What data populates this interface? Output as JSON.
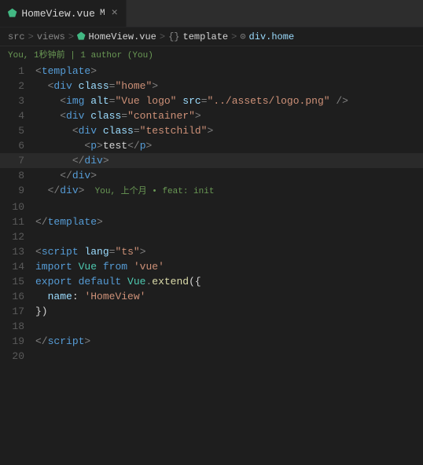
{
  "tab": {
    "vue_icon": "⬟",
    "label": "HomeView.vue",
    "modified": "M",
    "close": "×"
  },
  "breadcrumb": {
    "src": "src",
    "sep1": ">",
    "views": "views",
    "sep2": ">",
    "vue_icon": "⬟",
    "filename": "HomeView.vue",
    "sep3": ">",
    "tag_icon": "{}",
    "template": "template",
    "sep4": ">",
    "link_icon": "⊙",
    "divclass": "div.home"
  },
  "git_info": "You, 1秒钟前 | 1 author (You)",
  "lines": [
    {
      "num": "1",
      "tokens": [
        {
          "t": "tag",
          "v": "<"
        },
        {
          "t": "tag-name",
          "v": "template"
        },
        {
          "t": "tag",
          "v": ">"
        }
      ]
    },
    {
      "num": "2",
      "tokens": [
        {
          "t": "text-content",
          "v": "  "
        },
        {
          "t": "tag",
          "v": "<"
        },
        {
          "t": "tag-name",
          "v": "div"
        },
        {
          "t": "text-content",
          "v": " "
        },
        {
          "t": "attr-name",
          "v": "class"
        },
        {
          "t": "tag",
          "v": "="
        },
        {
          "t": "attr-value",
          "v": "\"home\""
        },
        {
          "t": "tag",
          "v": ">"
        }
      ]
    },
    {
      "num": "3",
      "tokens": [
        {
          "t": "text-content",
          "v": "    "
        },
        {
          "t": "tag",
          "v": "<"
        },
        {
          "t": "tag-name",
          "v": "img"
        },
        {
          "t": "text-content",
          "v": " "
        },
        {
          "t": "attr-name",
          "v": "alt"
        },
        {
          "t": "tag",
          "v": "="
        },
        {
          "t": "attr-value",
          "v": "\"Vue logo\""
        },
        {
          "t": "text-content",
          "v": " "
        },
        {
          "t": "attr-name",
          "v": "src"
        },
        {
          "t": "tag",
          "v": "="
        },
        {
          "t": "attr-value",
          "v": "\"../assets/logo.png\""
        },
        {
          "t": "text-content",
          "v": " "
        },
        {
          "t": "tag",
          "v": "/>"
        }
      ]
    },
    {
      "num": "4",
      "tokens": [
        {
          "t": "text-content",
          "v": "    "
        },
        {
          "t": "tag",
          "v": "<"
        },
        {
          "t": "tag-name",
          "v": "div"
        },
        {
          "t": "text-content",
          "v": " "
        },
        {
          "t": "attr-name",
          "v": "class"
        },
        {
          "t": "tag",
          "v": "="
        },
        {
          "t": "attr-value",
          "v": "\"container\""
        },
        {
          "t": "tag",
          "v": ">"
        }
      ]
    },
    {
      "num": "5",
      "tokens": [
        {
          "t": "text-content",
          "v": "      "
        },
        {
          "t": "tag",
          "v": "<"
        },
        {
          "t": "tag-name",
          "v": "div"
        },
        {
          "t": "text-content",
          "v": " "
        },
        {
          "t": "attr-name",
          "v": "class"
        },
        {
          "t": "tag",
          "v": "="
        },
        {
          "t": "attr-value",
          "v": "\"testchild\""
        },
        {
          "t": "tag",
          "v": ">"
        }
      ]
    },
    {
      "num": "6",
      "tokens": [
        {
          "t": "text-content",
          "v": "        "
        },
        {
          "t": "tag",
          "v": "<"
        },
        {
          "t": "tag-name",
          "v": "p"
        },
        {
          "t": "tag",
          "v": ">"
        },
        {
          "t": "text-content",
          "v": "test"
        },
        {
          "t": "tag",
          "v": "</"
        },
        {
          "t": "tag-name",
          "v": "p"
        },
        {
          "t": "tag",
          "v": ">"
        }
      ]
    },
    {
      "num": "7",
      "tokens": [
        {
          "t": "text-content",
          "v": "      "
        },
        {
          "t": "tag",
          "v": "</"
        },
        {
          "t": "tag-name",
          "v": "div"
        },
        {
          "t": "tag",
          "v": ">"
        }
      ],
      "active": true
    },
    {
      "num": "8",
      "tokens": [
        {
          "t": "text-content",
          "v": "    "
        },
        {
          "t": "tag",
          "v": "</"
        },
        {
          "t": "tag-name",
          "v": "div"
        },
        {
          "t": "tag",
          "v": ">"
        }
      ]
    },
    {
      "num": "9",
      "tokens": [
        {
          "t": "text-content",
          "v": "  "
        },
        {
          "t": "tag",
          "v": "</"
        },
        {
          "t": "tag-name",
          "v": "div"
        },
        {
          "t": "tag",
          "v": ">"
        },
        {
          "t": "git-annotation",
          "v": "  You, 上个月 • feat: init"
        }
      ]
    },
    {
      "num": "10",
      "tokens": []
    },
    {
      "num": "11",
      "tokens": [
        {
          "t": "tag",
          "v": "</"
        },
        {
          "t": "tag-name",
          "v": "template"
        },
        {
          "t": "tag",
          "v": ">"
        }
      ]
    },
    {
      "num": "12",
      "tokens": []
    },
    {
      "num": "13",
      "tokens": [
        {
          "t": "tag",
          "v": "<"
        },
        {
          "t": "tag-name",
          "v": "script"
        },
        {
          "t": "text-content",
          "v": " "
        },
        {
          "t": "attr-name",
          "v": "lang"
        },
        {
          "t": "tag",
          "v": "="
        },
        {
          "t": "attr-value",
          "v": "\"ts\""
        },
        {
          "t": "tag",
          "v": ">"
        }
      ]
    },
    {
      "num": "14",
      "tokens": [
        {
          "t": "keyword",
          "v": "import"
        },
        {
          "t": "text-content",
          "v": " "
        },
        {
          "t": "class-name",
          "v": "Vue"
        },
        {
          "t": "text-content",
          "v": " "
        },
        {
          "t": "keyword",
          "v": "from"
        },
        {
          "t": "text-content",
          "v": " "
        },
        {
          "t": "string",
          "v": "'vue'"
        }
      ]
    },
    {
      "num": "15",
      "tokens": [
        {
          "t": "keyword",
          "v": "export"
        },
        {
          "t": "text-content",
          "v": " "
        },
        {
          "t": "keyword",
          "v": "default"
        },
        {
          "t": "text-content",
          "v": " "
        },
        {
          "t": "class-name",
          "v": "Vue"
        },
        {
          "t": "tag",
          "v": "."
        },
        {
          "t": "function-name",
          "v": "extend"
        },
        {
          "t": "punctuation",
          "v": "({"
        }
      ]
    },
    {
      "num": "16",
      "tokens": [
        {
          "t": "text-content",
          "v": "  "
        },
        {
          "t": "property",
          "v": "name"
        },
        {
          "t": "punctuation",
          "v": ":"
        },
        {
          "t": "text-content",
          "v": " "
        },
        {
          "t": "string",
          "v": "'HomeView'"
        }
      ]
    },
    {
      "num": "17",
      "tokens": [
        {
          "t": "punctuation",
          "v": "})"
        }
      ]
    },
    {
      "num": "18",
      "tokens": []
    },
    {
      "num": "19",
      "tokens": [
        {
          "t": "tag",
          "v": "</"
        },
        {
          "t": "tag-name",
          "v": "script"
        },
        {
          "t": "tag",
          "v": ">"
        }
      ]
    },
    {
      "num": "20",
      "tokens": []
    }
  ]
}
